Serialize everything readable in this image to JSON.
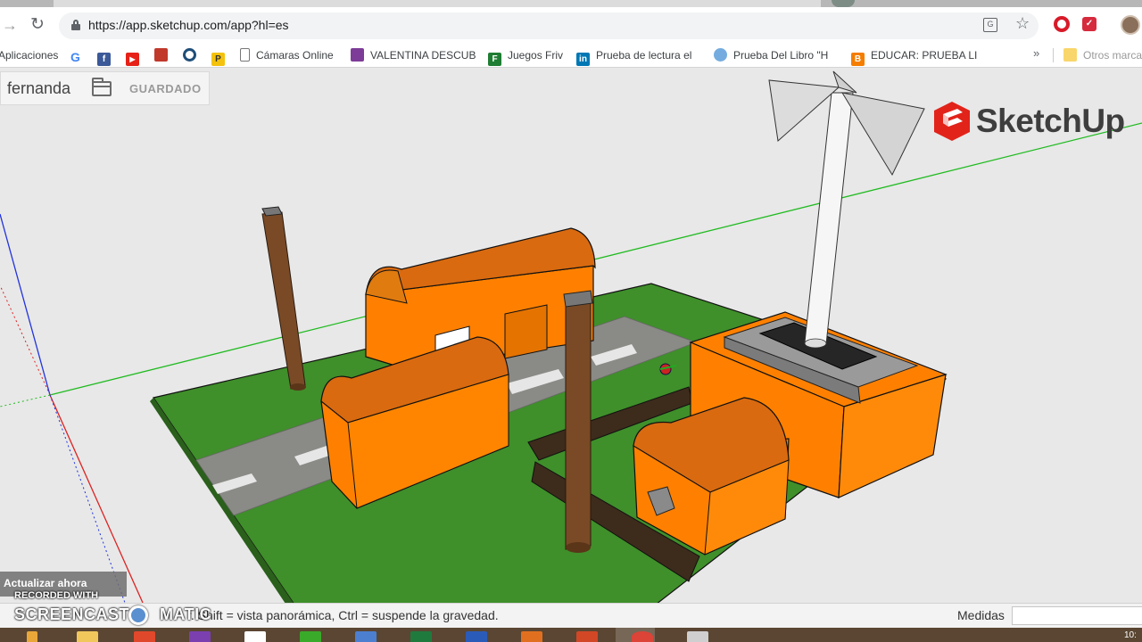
{
  "browser": {
    "url": "https://app.sketchup.com/app?hl=es",
    "bookmarks": [
      {
        "label": "Aplicaciones",
        "icon": "apps-icon",
        "color": ""
      },
      {
        "label": "",
        "icon": "google-icon",
        "color": "#4285f4"
      },
      {
        "label": "",
        "icon": "facebook-icon",
        "color": "#3b5998"
      },
      {
        "label": "",
        "icon": "youtube-icon",
        "color": "#e62117"
      },
      {
        "label": "",
        "icon": "bookmark-red-icon",
        "color": "#c0392b"
      },
      {
        "label": "",
        "icon": "circle-blue-icon",
        "color": "#1f4e79"
      },
      {
        "label": "",
        "icon": "p-yellow-icon",
        "color": "#f4c20d"
      },
      {
        "label": "Cámaras Online",
        "icon": "page-icon",
        "color": "#777777"
      },
      {
        "label": "VALENTINA DESCUB",
        "icon": "purple-app-icon",
        "color": "#7d3c98"
      },
      {
        "label": "Juegos Friv",
        "icon": "friv-icon",
        "color": "#1e7d32"
      },
      {
        "label": "Prueba de lectura el",
        "icon": "linkedin-icon",
        "color": "#0077b5"
      },
      {
        "label": "Prueba Del Libro \"H",
        "icon": "argentina-icon",
        "color": "#74acdf"
      },
      {
        "label": "EDUCAR: PRUEBA LI",
        "icon": "blogger-icon",
        "color": "#f57d00"
      }
    ],
    "other_bookmarks": "Otros marca"
  },
  "sketchup": {
    "file_name": "fernanda",
    "saved_label": "GUARDADO",
    "logo_text": "SketchUp",
    "status_text": "r. Shift = vista panorámica, Ctrl = suspende la gravedad.",
    "measure_label": "Medidas",
    "measure_value": ""
  },
  "overlay": {
    "update_text": "Actualizar ahora",
    "recorded_with": "RECORDED WITH",
    "brand": "SCREENCAST",
    "brand_suffix": "MATIC"
  },
  "taskbar": {
    "clock": "10:"
  },
  "colors": {
    "building_orange": "#ff8000",
    "roof_orange": "#d96a10",
    "grass": "#3f8f2a",
    "road": "#8a8a86",
    "wood": "#3d2b1c",
    "pole": "#7a4a26",
    "axis_red": "#dd2222",
    "axis_green": "#22bb22",
    "axis_blue": "#2233dd",
    "sketchup_red": "#e2231a"
  }
}
